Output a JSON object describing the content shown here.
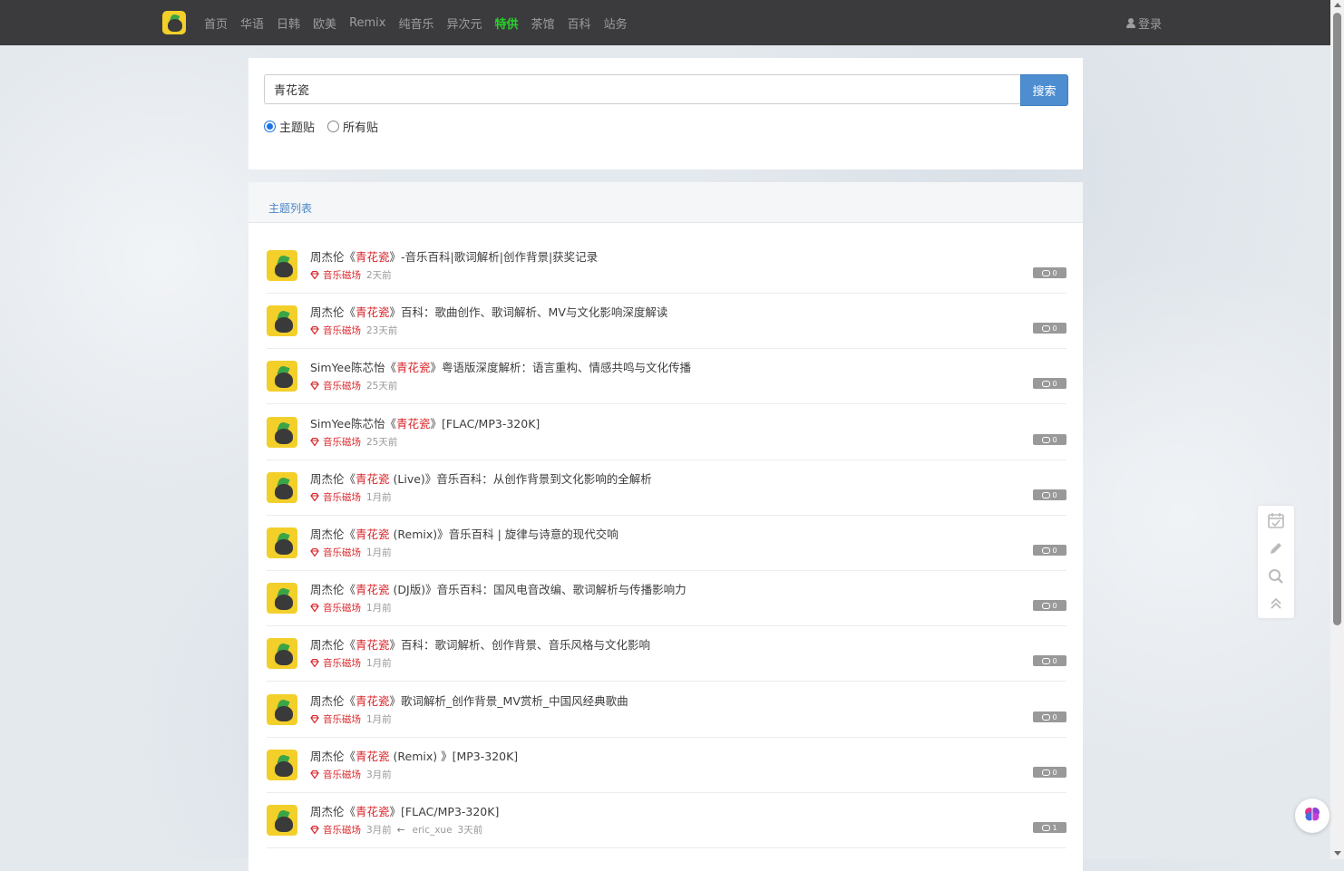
{
  "nav": {
    "items": [
      "首页",
      "华语",
      "日韩",
      "欧美",
      "Remix",
      "纯音乐",
      "异次元",
      "特供",
      "茶馆",
      "百科",
      "站务"
    ],
    "active_index": 7,
    "login_label": "登录"
  },
  "search": {
    "value": "青花瓷",
    "button_label": "搜索",
    "options": [
      {
        "label": "主题贴",
        "checked": true
      },
      {
        "label": "所有贴",
        "checked": false
      }
    ]
  },
  "list": {
    "title": "主题列表",
    "threads": [
      {
        "pre": "周杰伦《",
        "hl": "青花瓷",
        "post": "》-音乐百科|歌词解析|创作背景|获奖记录",
        "category": "音乐磁场",
        "time": "2天前",
        "replies": "0"
      },
      {
        "pre": "周杰伦《",
        "hl": "青花瓷",
        "post": "》百科：歌曲创作、歌词解析、MV与文化影响深度解读",
        "category": "音乐磁场",
        "time": "23天前",
        "replies": "0"
      },
      {
        "pre": "SimYee陈芯怡《",
        "hl": "青花瓷",
        "post": "》粤语版深度解析：语言重构、情感共鸣与文化传播",
        "category": "音乐磁场",
        "time": "25天前",
        "replies": "0"
      },
      {
        "pre": "SimYee陈芯怡《",
        "hl": "青花瓷",
        "post": "》[FLAC/MP3-320K]",
        "category": "音乐磁场",
        "time": "25天前",
        "replies": "0"
      },
      {
        "pre": "周杰伦《",
        "hl": "青花瓷",
        "post": " (Live)》音乐百科：从创作背景到文化影响的全解析",
        "category": "音乐磁场",
        "time": "1月前",
        "replies": "0"
      },
      {
        "pre": "周杰伦《",
        "hl": "青花瓷",
        "post": " (Remix)》音乐百科 | 旋律与诗意的现代交响",
        "category": "音乐磁场",
        "time": "1月前",
        "replies": "0"
      },
      {
        "pre": "周杰伦《",
        "hl": "青花瓷",
        "post": " (DJ版)》音乐百科：国风电音改编、歌词解析与传播影响力",
        "category": "音乐磁场",
        "time": "1月前",
        "replies": "0"
      },
      {
        "pre": "周杰伦《",
        "hl": "青花瓷",
        "post": "》百科：歌词解析、创作背景、音乐风格与文化影响",
        "category": "音乐磁场",
        "time": "1月前",
        "replies": "0"
      },
      {
        "pre": "周杰伦《",
        "hl": "青花瓷",
        "post": "》歌词解析_创作背景_MV赏析_中国风经典歌曲",
        "category": "音乐磁场",
        "time": "1月前",
        "replies": "0"
      },
      {
        "pre": "周杰伦《",
        "hl": "青花瓷",
        "post": " (Remix) 》[MP3-320K]",
        "category": "音乐磁场",
        "time": "3月前",
        "replies": "0"
      },
      {
        "pre": "周杰伦《",
        "hl": "青花瓷",
        "post": "》[FLAC/MP3-320K]",
        "category": "音乐磁场",
        "time": "3月前",
        "replies": "1",
        "last_user": "eric_xue",
        "last_time": "3天前"
      }
    ]
  },
  "colors": {
    "navbar_bg": "#3b3b3d",
    "nav_active": "#27d32a",
    "highlight": "#d9262b",
    "search_button": "#4d8dd0",
    "badge": "#999999"
  },
  "icons": {
    "side_tools": [
      "calendar-check-icon",
      "pencil-icon",
      "search-icon",
      "chevron-up-double-icon"
    ],
    "float": "brain-icon",
    "reply": "comment-icon",
    "category": "gem-icon",
    "reply_arrow": "←"
  }
}
